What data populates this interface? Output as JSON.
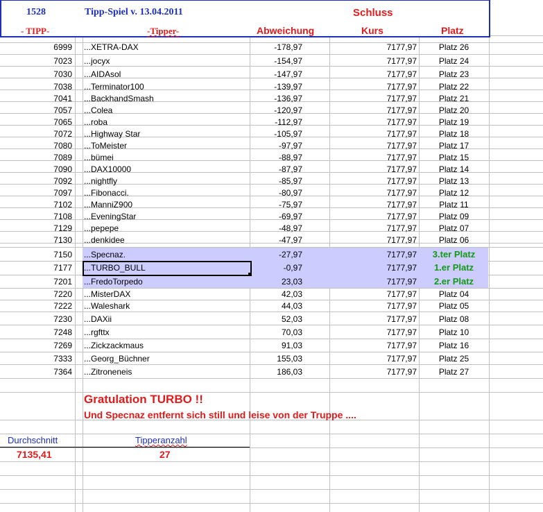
{
  "header": {
    "id": "1528",
    "title": "Tipp-Spiel v. 13.04.2011",
    "schluss": "Schluss",
    "col_tipp": "- TIPP-",
    "col_tipper": "-Tipper-",
    "col_abweichung": "Abweichung",
    "col_kurs": "Kurs",
    "col_platz": "Platz"
  },
  "rows": [
    {
      "tipp": "6999",
      "tipper": "...XETRA-DAX",
      "abw": "-178,97",
      "kurs": "7177,97",
      "platz": "Platz 26"
    },
    {
      "tipp": "7023",
      "tipper": "...jocyx",
      "abw": "-154,97",
      "kurs": "7177,97",
      "platz": "Platz 24"
    },
    {
      "tipp": "7030",
      "tipper": "...AIDAsol",
      "abw": "-147,97",
      "kurs": "7177,97",
      "platz": "Platz 23"
    },
    {
      "tipp": "7038",
      "tipper": "...Terminator100",
      "abw": "-139,97",
      "kurs": "7177,97",
      "platz": "Platz 22"
    },
    {
      "tipp": "7041",
      "tipper": "...BackhandSmash",
      "abw": "-136,97",
      "kurs": "7177,97",
      "platz": "Platz 21"
    },
    {
      "tipp": "7057",
      "tipper": "...Colea",
      "abw": "-120,97",
      "kurs": "7177,97",
      "platz": "Platz 20"
    },
    {
      "tipp": "7065",
      "tipper": "...roba",
      "abw": "-112,97",
      "kurs": "7177,97",
      "platz": "Platz 19"
    },
    {
      "tipp": "7072",
      "tipper": "...Highway Star",
      "abw": "-105,97",
      "kurs": "7177,97",
      "platz": "Platz 18"
    },
    {
      "tipp": "7080",
      "tipper": "...ToMeister",
      "abw": "-97,97",
      "kurs": "7177,97",
      "platz": "Platz 17"
    },
    {
      "tipp": "7089",
      "tipper": "...bümei",
      "abw": "-88,97",
      "kurs": "7177,97",
      "platz": "Platz 15"
    },
    {
      "tipp": "7090",
      "tipper": "...DAX10000",
      "abw": "-87,97",
      "kurs": "7177,97",
      "platz": "Platz 14"
    },
    {
      "tipp": "7092",
      "tipper": "...nightfly",
      "abw": "-85,97",
      "kurs": "7177,97",
      "platz": "Platz 13"
    },
    {
      "tipp": "7097",
      "tipper": "...Fibonacci.",
      "abw": "-80,97",
      "kurs": "7177,97",
      "platz": "Platz 12"
    },
    {
      "tipp": "7102",
      "tipper": "...ManniZ900",
      "abw": "-75,97",
      "kurs": "7177,97",
      "platz": "Platz 11"
    },
    {
      "tipp": "7108",
      "tipper": "...EveningStar",
      "abw": "-69,97",
      "kurs": "7177,97",
      "platz": "Platz 09"
    },
    {
      "tipp": "7129",
      "tipper": "...pepepe",
      "abw": "-48,97",
      "kurs": "7177,97",
      "platz": "Platz 07"
    },
    {
      "tipp": "7130",
      "tipper": "...denkidee",
      "abw": "-47,97",
      "kurs": "7177,97",
      "platz": "Platz 06"
    },
    {
      "tipp": "7150",
      "tipper": "...Specnaz.",
      "abw": "-27,97",
      "kurs": "7177,97",
      "platz": "3.ter Platz"
    },
    {
      "tipp": "7177",
      "tipper": "...TURBO_BULL",
      "abw": "-0,97",
      "kurs": "7177,97",
      "platz": "1.er Platz"
    },
    {
      "tipp": "7201",
      "tipper": "...FredoTorpedo",
      "abw": "23,03",
      "kurs": "7177,97",
      "platz": "2.er Platz"
    },
    {
      "tipp": "7220",
      "tipper": "...MisterDAX",
      "abw": "42,03",
      "kurs": "7177,97",
      "platz": "Platz 04"
    },
    {
      "tipp": "7222",
      "tipper": "...Waleshark",
      "abw": "44,03",
      "kurs": "7177,97",
      "platz": "Platz 05"
    },
    {
      "tipp": "7230",
      "tipper": "...DAXii",
      "abw": "52,03",
      "kurs": "7177,97",
      "platz": "Platz 08"
    },
    {
      "tipp": "7248",
      "tipper": "...rgfttx",
      "abw": "70,03",
      "kurs": "7177,97",
      "platz": "Platz 10"
    },
    {
      "tipp": "7269",
      "tipper": "...Zickzackmaus",
      "abw": "91,03",
      "kurs": "7177,97",
      "platz": "Platz 16"
    },
    {
      "tipp": "7333",
      "tipper": "...Georg_Büchner",
      "abw": "155,03",
      "kurs": "7177,97",
      "platz": "Platz 25"
    },
    {
      "tipp": "7364",
      "tipper": "...Zitroneneis",
      "abw": "186,03",
      "kurs": "7177,97",
      "platz": "Platz 27"
    }
  ],
  "message": {
    "headline": "Gratulation TURBO !!",
    "line": "Und Specnaz entfernt sich still und leise von der Truppe ...."
  },
  "summary": {
    "durchschnitt_label": "Durchschnitt",
    "durchschnitt_value": "7135,41",
    "tipperanzahl_label": "Tipperanzahl",
    "tipperanzahl_value": "27"
  },
  "colors": {
    "header_blue": "#1d2fb8",
    "accent_red": "#e01b1b",
    "winner_green": "#129a12",
    "highlight": "#ccccff"
  }
}
